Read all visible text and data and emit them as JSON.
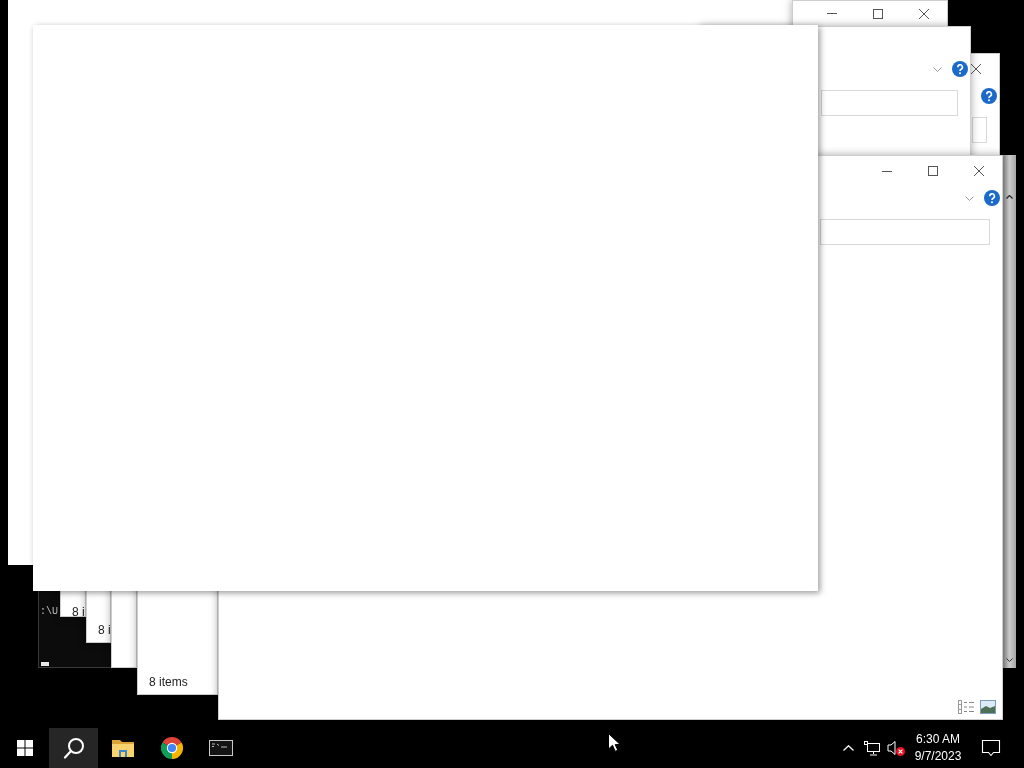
{
  "windows": [
    {
      "kind": "blank"
    },
    {
      "kind": "explorer",
      "title_buttons": true
    },
    {
      "kind": "explorer",
      "title_buttons": true,
      "ribbon": true
    },
    {
      "kind": "explorer",
      "ribbon": true
    },
    {
      "kind": "console",
      "text": ":\\U"
    },
    {
      "kind": "explorer",
      "status": "8 i"
    },
    {
      "kind": "explorer",
      "status": "8 i"
    },
    {
      "kind": "explorer"
    },
    {
      "kind": "explorer",
      "status": "8 items"
    },
    {
      "kind": "explorer",
      "title_buttons": true,
      "ribbon": true,
      "view_buttons": true
    },
    {
      "kind": "blank"
    }
  ],
  "taskbar": {
    "items": [
      {
        "kind": "start",
        "highlighted": false
      },
      {
        "kind": "search",
        "highlighted": true
      },
      {
        "kind": "folder",
        "highlighted": false
      },
      {
        "kind": "browser",
        "highlighted": false
      },
      {
        "kind": "terminal",
        "highlighted": false
      }
    ],
    "tray": {
      "volume_muted": true,
      "time": "6:30 AM",
      "date": "9/7/2023"
    }
  }
}
